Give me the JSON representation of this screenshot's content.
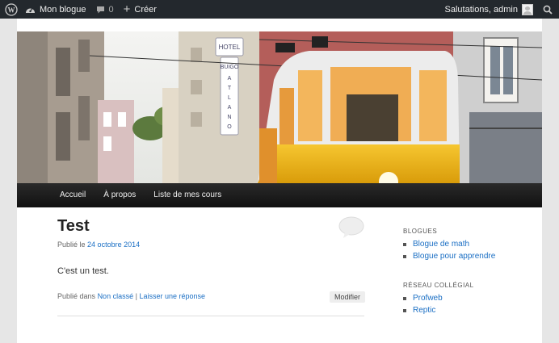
{
  "adminbar": {
    "site_name": "Mon blogue",
    "comments_count": "0",
    "new_label": "Créer",
    "greeting": "Salutations, admin"
  },
  "nav": {
    "items": [
      {
        "label": "Accueil"
      },
      {
        "label": "À propos"
      },
      {
        "label": "Liste de mes cours"
      }
    ]
  },
  "post": {
    "title": "Test",
    "posted_prefix": "Publié le",
    "date": "24 octobre 2014",
    "body": "C'est un test.",
    "published_in": "Publié dans",
    "category": "Non classé",
    "separator": "|",
    "reply": "Laisser une réponse",
    "edit": "Modifier"
  },
  "sidebar": {
    "widgets": [
      {
        "title": "BLOGUES",
        "links": [
          "Blogue de math",
          "Blogue pour apprendre"
        ]
      },
      {
        "title": "RÉSEAU COLLÉGIAL",
        "links": [
          "Profweb",
          "Reptic"
        ]
      }
    ]
  },
  "colors": {
    "link": "#1b6fc4",
    "adminbar": "#23282d",
    "tram_yellow": "#f2b718"
  }
}
